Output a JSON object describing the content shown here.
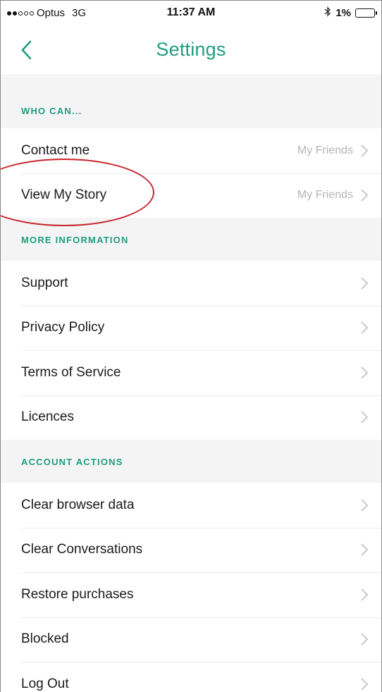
{
  "status_bar": {
    "carrier": "Optus",
    "network": "3G",
    "time": "11:37 AM",
    "battery": "1%",
    "signal_bars": 2
  },
  "nav": {
    "title": "Settings",
    "back_icon": "chevron-left-icon"
  },
  "sections": [
    {
      "header": "WHO CAN...",
      "rows": [
        {
          "label": "Contact me",
          "value": "My Friends"
        },
        {
          "label": "View My Story",
          "value": "My Friends"
        }
      ]
    },
    {
      "header": "MORE INFORMATION",
      "rows": [
        {
          "label": "Support"
        },
        {
          "label": "Privacy Policy"
        },
        {
          "label": "Terms of Service"
        },
        {
          "label": "Licences"
        }
      ]
    },
    {
      "header": "ACCOUNT ACTIONS",
      "rows": [
        {
          "label": "Clear browser data"
        },
        {
          "label": "Clear Conversations"
        },
        {
          "label": "Restore purchases"
        },
        {
          "label": "Blocked"
        },
        {
          "label": "Log Out"
        }
      ]
    }
  ],
  "colors": {
    "accent": "#1f9e80",
    "annotation": "#c8232c",
    "section_bg": "#f4f4f4",
    "value_text": "#b5b5b5"
  }
}
